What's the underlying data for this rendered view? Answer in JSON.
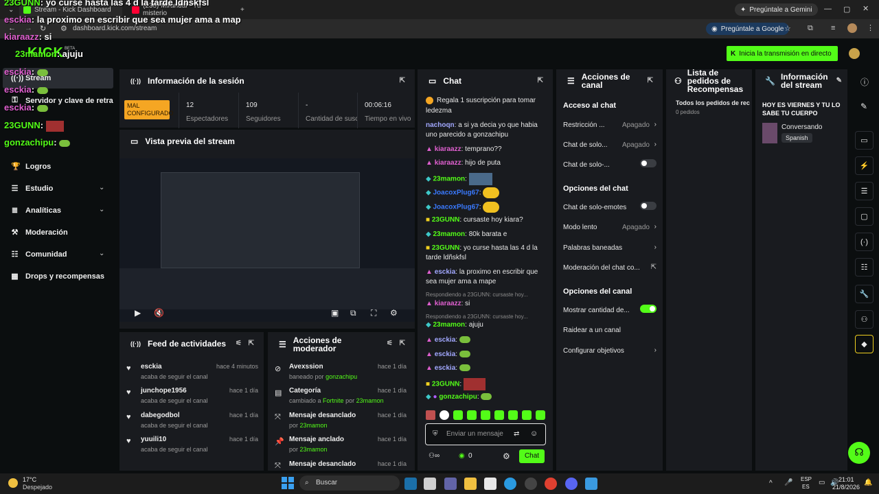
{
  "browser": {
    "tabs": [
      {
        "label": "Stream - Kick Dashboard"
      },
      {
        "label": "(238) Mirandal - Tu misterio"
      }
    ],
    "url": "dashboard.kick.com/stream",
    "gemini_pill": "Pregúntale a Gemini",
    "google_pill": "Pregúntale a Google"
  },
  "overlay": [
    {
      "user": "23GUNN",
      "text": ": yo curse hasta las 4 d la tarde ldñskfsl"
    },
    {
      "user": "esckia",
      "text": ": la proximo en escribir que sea mujer ama a map"
    },
    {
      "user": "kiaraazz",
      "text": ": si"
    },
    {
      "user": "23mamon",
      "text": ": ajuju"
    },
    {
      "user": "esckia",
      "text": ":"
    },
    {
      "user": "esckia",
      "text": ":"
    },
    {
      "user": "esckia",
      "text": ":"
    },
    {
      "user": "23GUNN",
      "text": ":"
    },
    {
      "user": "gonzachipu",
      "text": ":"
    }
  ],
  "kick": {
    "start_button": "Inicia la transmisión en directo"
  },
  "sidebar": {
    "items": [
      {
        "label": "Stream"
      },
      {
        "label": "Servidor y clave de retransmisión"
      },
      {
        "label": "Logros"
      },
      {
        "label": "Estudio"
      },
      {
        "label": "Analíticas"
      },
      {
        "label": "Moderación"
      },
      {
        "label": "Comunidad"
      },
      {
        "label": "Drops y recompensas"
      }
    ],
    "beta": "BETA"
  },
  "session": {
    "title": "Información de la sesión",
    "badge": "MAL CONFIGURADO",
    "stats": [
      {
        "value": "12",
        "label": "Espectadores"
      },
      {
        "value": "109",
        "label": "Seguidores"
      },
      {
        "value": "-",
        "label": "Cantidad de suscripciones"
      },
      {
        "value": "00:06:16",
        "label": "Tiempo en vivo"
      }
    ]
  },
  "preview": {
    "title": "Vista previa del stream"
  },
  "feed": {
    "title": "Feed de actividades",
    "items": [
      {
        "name": "esckia",
        "sub": "acaba de seguir el canal",
        "time": "hace 4 minutos"
      },
      {
        "name": "junchope1956",
        "sub": "acaba de seguir el canal",
        "time": "hace 1 día"
      },
      {
        "name": "dabegodbol",
        "sub": "acaba de seguir el canal",
        "time": "hace 1 día"
      },
      {
        "name": "yuuili10",
        "sub": "acaba de seguir el canal",
        "time": "hace 1 día"
      }
    ]
  },
  "modactions": {
    "title": "Acciones de moderador",
    "items": [
      {
        "name": "Avexssion",
        "pre": "baneado por",
        "by": "gonzachipu",
        "time": "hace 1 día"
      },
      {
        "name": "Categoría",
        "pre": "cambiado a",
        "by": "Fortnite",
        "post": "por",
        "by2": "23mamon",
        "time": "hace 1 día"
      },
      {
        "name": "Mensaje desanclado",
        "pre": "por",
        "by": "23mamon",
        "time": "hace 1 día"
      },
      {
        "name": "Mensaje anclado",
        "pre": "por",
        "by": "23mamon",
        "time": "hace 1 día"
      },
      {
        "name": "Mensaje desanclado",
        "pre": "",
        "by": "",
        "time": "hace 1 día"
      }
    ]
  },
  "chat": {
    "title": "Chat",
    "pinned": "Regala 1 suscripción para tomar",
    "lines": [
      {
        "user": "",
        "text": "ledezma"
      },
      {
        "user": "nachoqn",
        "text": ": a si ya decia yo que habia uno parecido a gonzachipu"
      },
      {
        "user": "kiaraazz",
        "text": ": temprano??"
      },
      {
        "user": "kiaraazz",
        "text": ": hijo de puta"
      },
      {
        "user": "23mamon",
        "text": ":"
      },
      {
        "user": "JoacoxPlug67",
        "text": ":"
      },
      {
        "user": "JoacoxPlug67",
        "text": ":"
      },
      {
        "user": "23GUNN",
        "text": ": cursaste hoy kiara?"
      },
      {
        "user": "23mamon",
        "text": ": 80k barata e"
      },
      {
        "user": "23GUNN",
        "text": ": yo curse hasta las 4 d la tarde ldñskfsl"
      },
      {
        "user": "esckia",
        "text": ": la proximo en escribir que sea mujer ama a mape"
      },
      {
        "user": "kiaraazz",
        "text": ": si"
      },
      {
        "user": "23mamon",
        "text": ": ajuju"
      },
      {
        "user": "esckia",
        "text": ":"
      },
      {
        "user": "esckia",
        "text": ":"
      },
      {
        "user": "esckia",
        "text": ":"
      },
      {
        "user": "23GUNN",
        "text": ":"
      },
      {
        "user": "gonzachipu",
        "text": ":"
      }
    ],
    "replies": [
      "Respondiendo a 23GUNN: cursaste hoy...",
      "Respondiendo a 23GUNN: cursaste hoy..."
    ],
    "placeholder": "Enviar un mensaje",
    "viewers": "0",
    "send": "Chat"
  },
  "canal": {
    "title": "Acciones de canal",
    "acceso": "Acceso al chat",
    "opciones_chat": "Opciones del chat",
    "opciones_canal": "Opciones del canal",
    "rows": [
      {
        "label": "Restricción ...",
        "value": "Apagado"
      },
      {
        "label": "Chat de solo...",
        "value": "Apagado"
      },
      {
        "label": "Chat de solo-...",
        "value": ""
      },
      {
        "label": "Chat de solo-emotes",
        "value": ""
      },
      {
        "label": "Modo lento",
        "value": "Apagado"
      },
      {
        "label": "Palabras baneadas",
        "value": ""
      },
      {
        "label": "Moderación del chat co...",
        "value": ""
      },
      {
        "label": "Mostrar cantidad de...",
        "value": ""
      },
      {
        "label": "Raidear a un canal",
        "value": ""
      },
      {
        "label": "Configurar objetivos",
        "value": ""
      }
    ]
  },
  "rewards": {
    "title": "Lista de pedidos de Recompensas",
    "sub": "Todos los pedidos de rec",
    "count": "0 pedidos"
  },
  "streaminfo": {
    "title": "Información del stream",
    "text": "HOY ES VIERNES Y TU LO SABE TU CUERPO",
    "category": "Conversando",
    "language": "Spanish"
  },
  "taskbar": {
    "weather": "17°C",
    "weather_desc": "Despejado",
    "search": "Buscar",
    "lang": "ESP",
    "lang2": "ES",
    "time": "21:01",
    "date": "21/8/2026"
  },
  "colors": {
    "accent": "#53fc18",
    "warning": "#f5a623",
    "panel": "#191b1f"
  }
}
